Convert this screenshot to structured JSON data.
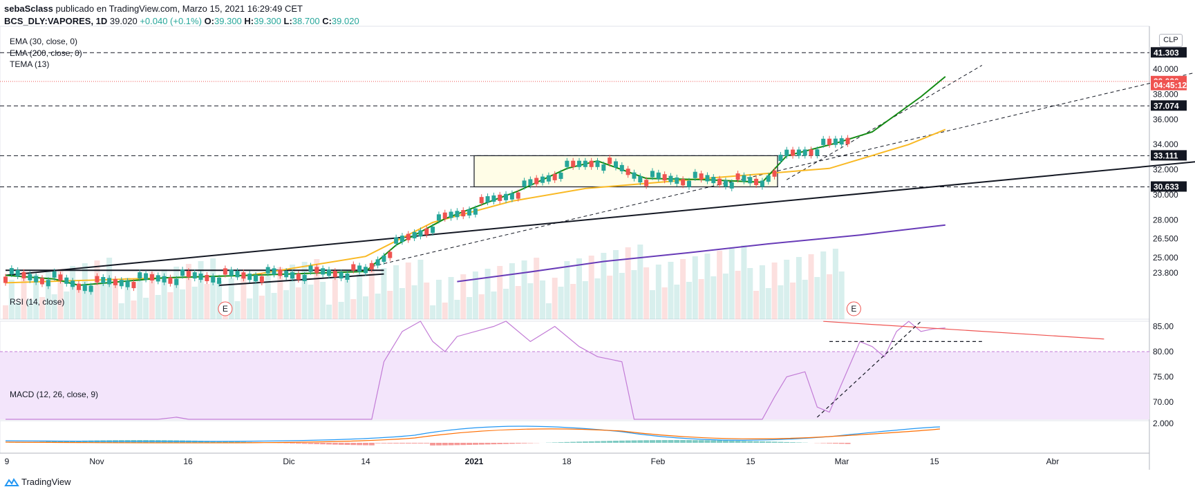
{
  "header": {
    "author": "sebaSclass",
    "published_text": "publicado en TradingView.com, Marzo 15, 2021 16:29:49 CET",
    "symbol": "BCS_DLY:VAPORES, 1D",
    "last": "39.020",
    "change": "+0.040 (+0.1%)",
    "o_key": "O:",
    "o_val": "39.300",
    "h_key": "H:",
    "h_val": "39.300",
    "l_key": "L:",
    "l_val": "38.700",
    "c_key": "C:",
    "c_val": "39.020"
  },
  "currency": "CLP",
  "footer": {
    "brand": "TradingView"
  },
  "colors": {
    "up": "#26a69a",
    "down": "#ef5350",
    "ema30": "#f9b924",
    "ema200": "#673ab7",
    "tema": "#138a13",
    "rsi": "#c27bd6",
    "macd": "#2196f3",
    "signal": "#ff6d00"
  },
  "chart_data": [
    {
      "type": "candlestick",
      "title": "BCS_DLY:VAPORES, 1D",
      "indicators": [
        "EMA (30, close, 0)",
        "EMA (200, close, 0)",
        "TEMA (13)"
      ],
      "ylim": [
        23.0,
        41.8
      ],
      "y_ticks": [
        "40.000",
        "38.000",
        "36.000",
        "34.000",
        "32.000",
        "30.000",
        "28.000",
        "26.500",
        "25.000",
        "23.800"
      ],
      "x_ticks": [
        "9",
        "Nov",
        "16",
        "Dic",
        "14",
        "2021",
        "18",
        "Feb",
        "15",
        "Mar",
        "15",
        "Abr"
      ],
      "price_tags": [
        {
          "label": "41.303",
          "value": 41.303,
          "style": "dark"
        },
        {
          "label": "39.020",
          "value": 39.02,
          "style": "red"
        },
        {
          "label": "04:45:12",
          "value": 38.7,
          "style": "red"
        },
        {
          "label": "37.074",
          "value": 37.074,
          "style": "dark"
        },
        {
          "label": "33.111",
          "value": 33.111,
          "style": "dark"
        },
        {
          "label": "30.633",
          "value": 30.633,
          "style": "dark"
        }
      ],
      "horizontal_levels": [
        41.303,
        37.074,
        33.111,
        30.633
      ],
      "range_box": {
        "from": "2021-01-01",
        "to": "2021-02-17",
        "low": 30.633,
        "high": 33.111
      },
      "series": {
        "ema30": [
          [
            0,
            23.0
          ],
          [
            20,
            23.3
          ],
          [
            40,
            23.6
          ],
          [
            59,
            25.1
          ],
          [
            70,
            27.8
          ],
          [
            83,
            29.5
          ],
          [
            95,
            30.5
          ],
          [
            112,
            31.2
          ],
          [
            135,
            32.1
          ],
          [
            148,
            34.0
          ],
          [
            154,
            35.2
          ]
        ],
        "ema200": [
          [
            74,
            23.1
          ],
          [
            85,
            23.8
          ],
          [
            98,
            24.7
          ],
          [
            112,
            25.4
          ],
          [
            125,
            26.1
          ],
          [
            140,
            26.8
          ],
          [
            154,
            27.6
          ]
        ],
        "tema": [
          [
            0,
            23.6
          ],
          [
            8,
            23.3
          ],
          [
            12,
            22.8
          ],
          [
            26,
            23.4
          ],
          [
            40,
            23.6
          ],
          [
            59,
            23.9
          ],
          [
            64,
            26.0
          ],
          [
            72,
            28.1
          ],
          [
            79,
            29.4
          ],
          [
            84,
            30.3
          ],
          [
            92,
            32.1
          ],
          [
            97,
            32.7
          ],
          [
            105,
            31.3
          ],
          [
            115,
            31.2
          ],
          [
            124,
            31.0
          ],
          [
            128,
            33.1
          ],
          [
            136,
            34.1
          ],
          [
            142,
            35.0
          ],
          [
            146,
            36.4
          ],
          [
            150,
            37.8
          ],
          [
            154,
            39.4
          ]
        ]
      },
      "trendlines": [
        {
          "style": "solid",
          "from": [
            0,
            23.6
          ],
          "to": [
            203,
            33.0
          ]
        },
        {
          "style": "dashed",
          "from": [
            60,
            24.3
          ],
          "to": [
            200,
            40.3
          ]
        },
        {
          "style": "dashed",
          "from": [
            128,
            31.2
          ],
          "to": [
            160,
            40.3
          ]
        },
        {
          "style": "solid",
          "from": [
            0,
            24.0
          ],
          "to": [
            62,
            24.0
          ]
        },
        {
          "style": "solid",
          "from": [
            35,
            22.8
          ],
          "to": [
            62,
            23.7
          ]
        }
      ],
      "earnings_marks": [
        {
          "x": 36,
          "label": "E"
        },
        {
          "x": 139,
          "label": "E"
        }
      ]
    },
    {
      "type": "line",
      "title": "RSI (14, close)",
      "ylim": [
        66,
        86.5
      ],
      "y_ticks": [
        "85.00",
        "80.00",
        "75.00",
        "70.00"
      ],
      "overbought": 80,
      "values": [
        [
          0,
          66
        ],
        [
          5,
          60
        ],
        [
          25,
          58
        ],
        [
          28,
          67
        ],
        [
          30,
          65
        ],
        [
          55,
          58
        ],
        [
          60,
          66
        ],
        [
          62,
          78
        ],
        [
          65,
          84
        ],
        [
          68,
          88
        ],
        [
          70,
          82
        ],
        [
          72,
          80
        ],
        [
          74,
          83
        ],
        [
          77,
          84
        ],
        [
          80,
          85
        ],
        [
          82,
          88
        ],
        [
          86,
          82
        ],
        [
          90,
          85
        ],
        [
          94,
          81
        ],
        [
          97,
          79
        ],
        [
          101,
          78
        ],
        [
          103,
          60
        ],
        [
          124,
          60
        ],
        [
          126,
          71
        ],
        [
          128,
          75
        ],
        [
          131,
          76
        ],
        [
          133,
          69
        ],
        [
          135,
          68
        ],
        [
          140,
          82
        ],
        [
          142,
          81
        ],
        [
          144,
          79
        ],
        [
          146,
          84
        ],
        [
          148,
          86
        ],
        [
          150,
          84
        ],
        [
          152,
          84.5
        ],
        [
          154,
          84.7
        ]
      ],
      "trendlines": [
        {
          "style": "solid",
          "color": "#ef5350",
          "from": [
            134,
            86
          ],
          "to": [
            180,
            82.5
          ]
        },
        {
          "style": "dashed",
          "from": [
            133,
            67
          ],
          "to": [
            150,
            86
          ]
        },
        {
          "style": "dashed",
          "from": [
            135,
            82
          ],
          "to": [
            160,
            82
          ]
        }
      ]
    },
    {
      "type": "histogram+line",
      "title": "MACD (12, 26, close, 9)",
      "y_ticks": [
        "2.000"
      ]
    }
  ]
}
